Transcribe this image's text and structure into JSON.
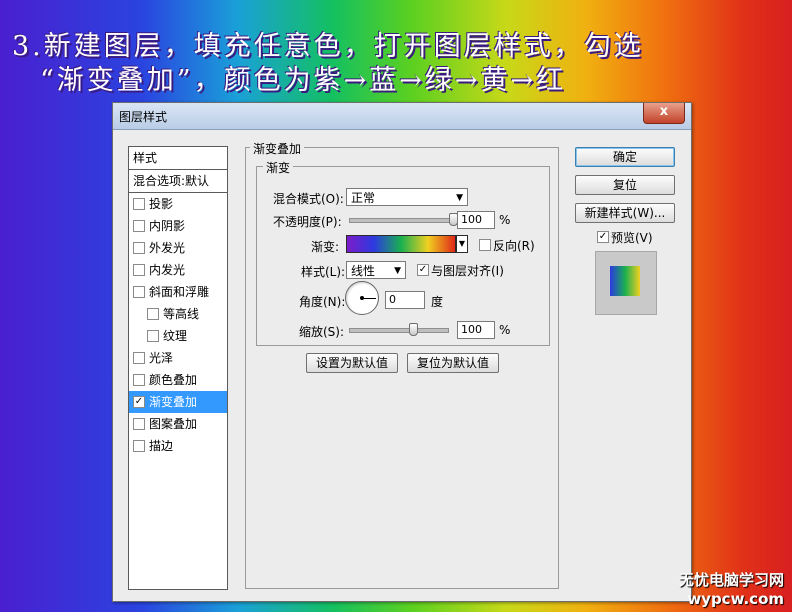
{
  "caption": {
    "line1": "3.新建图层，填充任意色，打开图层样式，勾选",
    "line2": "“渐变叠加”，颜色为紫→蓝→绿→黄→红"
  },
  "dialog": {
    "title": "图层样式",
    "close_label": "x",
    "style_list": {
      "header": "样式",
      "blend_options": "混合选项:默认",
      "items": [
        {
          "label": "投影"
        },
        {
          "label": "内阴影"
        },
        {
          "label": "外发光"
        },
        {
          "label": "内发光"
        },
        {
          "label": "斜面和浮雕"
        },
        {
          "label": "等高线"
        },
        {
          "label": "纹理"
        },
        {
          "label": "光泽"
        },
        {
          "label": "颜色叠加"
        },
        {
          "label": "渐变叠加"
        },
        {
          "label": "图案叠加"
        },
        {
          "label": "描边"
        }
      ]
    },
    "panel": {
      "group_title": "渐变叠加",
      "subgroup_title": "渐变",
      "blend_mode_label": "混合模式(O):",
      "blend_mode_value": "正常",
      "opacity_label": "不透明度(P):",
      "opacity_value": "100",
      "opacity_unit": "%",
      "opacity_level": 1.0,
      "gradient_label": "渐变:",
      "gradient_colors": [
        "#7c1cc8",
        "#2c3ae0",
        "#19b050",
        "#f0d020",
        "#e02818"
      ],
      "reverse_label": "反向(R)",
      "style_label": "样式(L):",
      "style_value": "线性",
      "align_label": "与图层对齐(I)",
      "angle_label": "角度(N):",
      "angle_value": "0",
      "angle_unit": "度",
      "scale_label": "缩放(S):",
      "scale_value": "100",
      "scale_unit": "%",
      "scale_level": 0.65,
      "set_default_label": "设置为默认值",
      "reset_default_label": "复位为默认值"
    },
    "buttons": {
      "ok": "确定",
      "reset": "复位",
      "new_style": "新建样式(W)...",
      "preview": "预览(V)"
    }
  },
  "watermark": {
    "line1": "无忧电脑学习网",
    "line2": "wypcw.com"
  }
}
